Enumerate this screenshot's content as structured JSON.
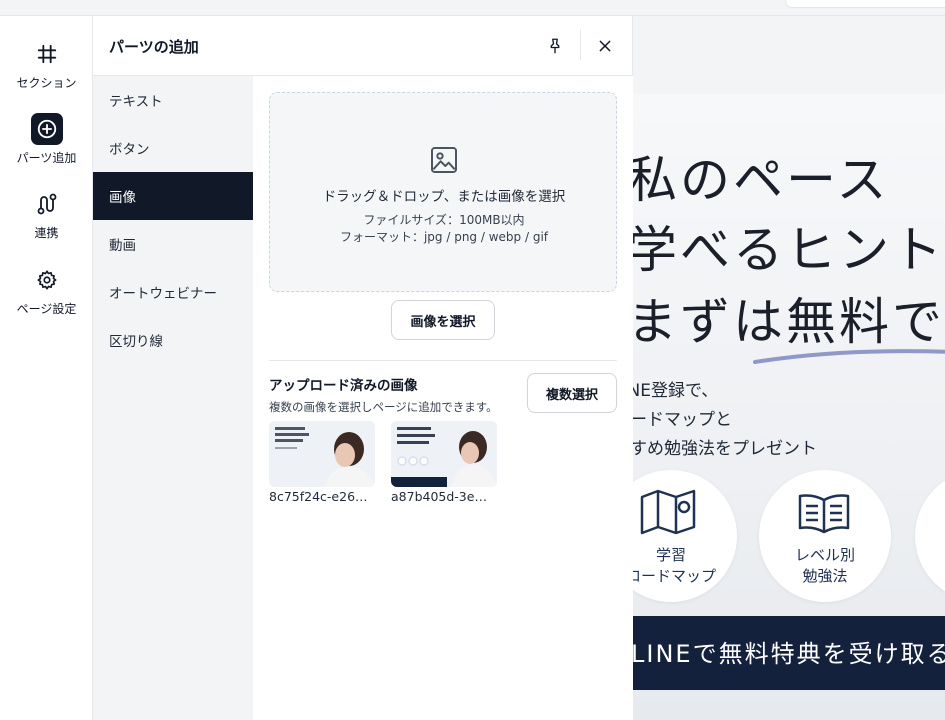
{
  "rail": {
    "items": [
      {
        "label": "セクション",
        "icon": "hash-icon"
      },
      {
        "label": "パーツ追加",
        "icon": "plus-circle-icon",
        "active": true
      },
      {
        "label": "連携",
        "icon": "route-icon"
      },
      {
        "label": "ページ設定",
        "icon": "gear-icon"
      }
    ]
  },
  "panel": {
    "title": "パーツの追加",
    "categories": [
      "テキスト",
      "ボタン",
      "画像",
      "動画",
      "オートウェビナー",
      "区切り線"
    ],
    "active_category": "画像",
    "dropzone": {
      "main": "ドラッグ＆ドロップ、または画像を選択",
      "size_note": "ファイルサイズ：100MB以内",
      "format_note": "フォーマット：jpg / png / webp / gif"
    },
    "select_button": "画像を選択",
    "uploaded": {
      "title": "アップロード済みの画像",
      "description": "複数の画像を選択しページに追加できます。",
      "multi_button": "複数選択",
      "files": [
        "8c75f24c-e26…",
        "a87b405d-3e…"
      ]
    }
  },
  "preview": {
    "headline": [
      "私のペース",
      "学べるヒント",
      "まずは無料で"
    ],
    "body": [
      "LINE登録で、",
      "ロードマップと",
      "すすめ勉強法をプレゼント"
    ],
    "features": [
      {
        "line1": "学習",
        "line2": "ロードマップ",
        "icon": "map-icon"
      },
      {
        "line1": "レベル別",
        "line2": "勉強法",
        "icon": "book-icon"
      }
    ],
    "cta": "LINEで無料特典を受け取る"
  },
  "colors": {
    "active_bg": "#111827",
    "panel_bg": "#ffffff",
    "category_bg": "#f3f4f6",
    "cta_bg": "#14213d",
    "accent_underline": "#8e99c9"
  }
}
